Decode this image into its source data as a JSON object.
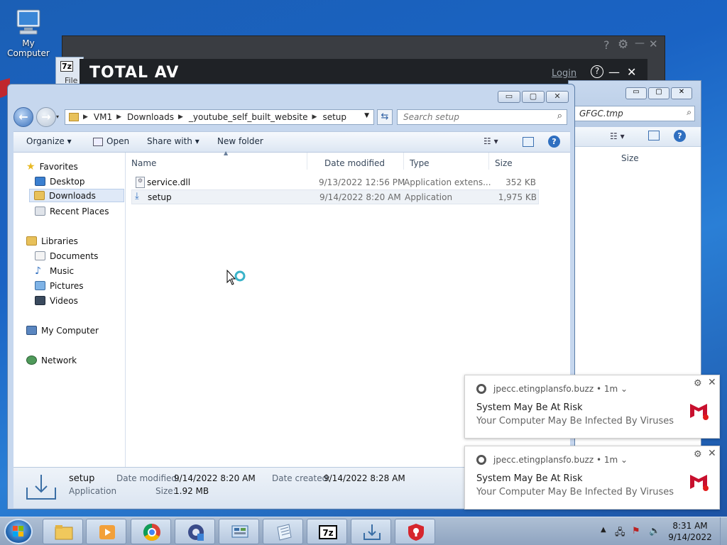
{
  "desktop": {
    "icons": [
      {
        "label": "My Computer"
      }
    ]
  },
  "totalav": {
    "brand": "TOTAL AV",
    "login": "Login",
    "help_icon": "?",
    "minimize_icon": "—",
    "close_icon": "✕"
  },
  "zip_window": {
    "title_fragment": "7z",
    "menu_fragment": "File"
  },
  "right_window": {
    "address_fragment": "GFGC.tmp",
    "size_header": "Size"
  },
  "explorer": {
    "window_buttons": [
      "▭",
      "▢",
      "✕"
    ],
    "breadcrumb": [
      "VM1",
      "Downloads",
      "_youtube_self_built_website",
      "setup"
    ],
    "search_placeholder": "Search setup",
    "toolbar": {
      "organize": "Organize ▾",
      "open": "Open",
      "share_with": "Share with ▾",
      "new_folder": "New folder"
    },
    "sidebar": {
      "favorites": "Favorites",
      "desktop": "Desktop",
      "downloads": "Downloads",
      "recent_places": "Recent Places",
      "libraries": "Libraries",
      "documents": "Documents",
      "music": "Music",
      "pictures": "Pictures",
      "videos": "Videos",
      "my_computer": "My Computer",
      "network": "Network"
    },
    "columns": {
      "name": "Name",
      "date_modified": "Date modified",
      "type": "Type",
      "size": "Size"
    },
    "files": [
      {
        "name": "service.dll",
        "date": "9/13/2022 12:56 PM",
        "type": "Application extens...",
        "size": "352 KB"
      },
      {
        "name": "setup",
        "date": "9/14/2022 8:20 AM",
        "type": "Application",
        "size": "1,975 KB"
      }
    ],
    "details": {
      "name": "setup",
      "type": "Application",
      "date_modified_label": "Date modified:",
      "date_modified": "9/14/2022 8:20 AM",
      "date_created_label": "Date created:",
      "date_created": "9/14/2022 8:28 AM",
      "size_label": "Size:",
      "size": "1.92 MB"
    }
  },
  "notifications": [
    {
      "source": "jpecc.etingplansfo.buzz • 1m ⌄",
      "title": "System May Be At Risk",
      "body": "Your Computer May Be Infected By Viruses"
    },
    {
      "source": "jpecc.etingplansfo.buzz • 1m ⌄",
      "title": "System May Be At Risk",
      "body": "Your Computer May Be Infected By Viruses"
    }
  ],
  "taskbar": {
    "apps": [
      "file-explorer",
      "media-player",
      "chrome",
      "settings-shield",
      "control-panel",
      "notepad",
      "7zip",
      "downloader",
      "antivirus"
    ],
    "clock_time": "8:31 AM",
    "clock_date": "9/14/2022"
  }
}
